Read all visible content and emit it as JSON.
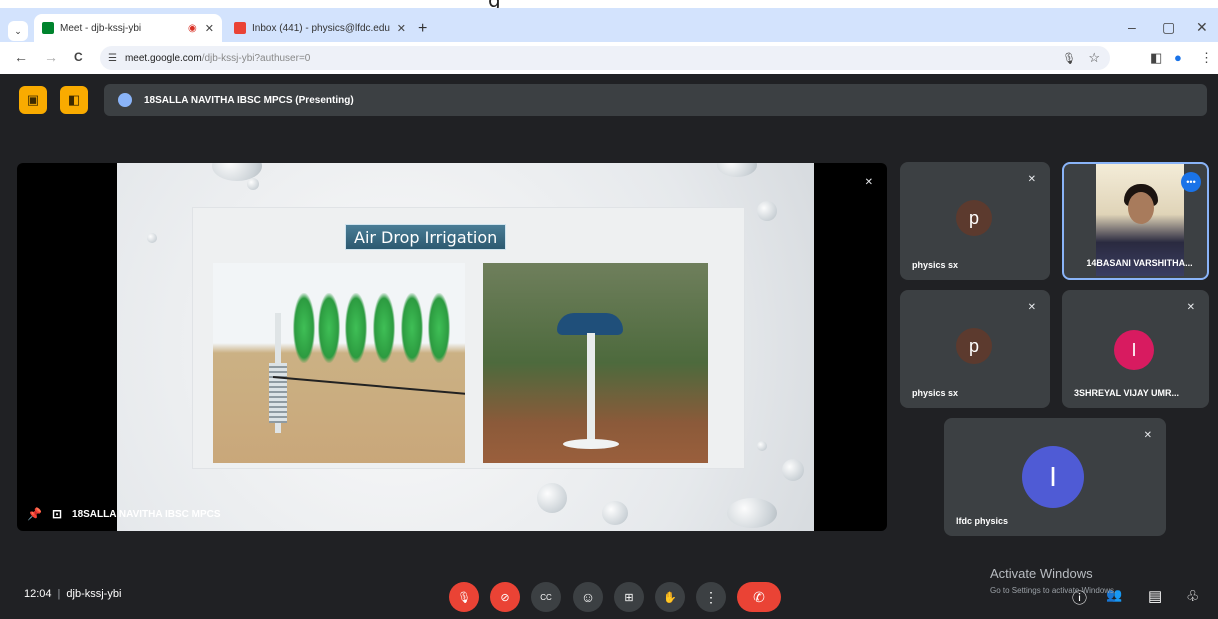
{
  "browser": {
    "tabs": [
      {
        "label": "Meet - djb-kssj-ybi",
        "recording": "◉",
        "close": "✕"
      },
      {
        "label": "Inbox (441) - physics@lfdc.edu",
        "close": "✕"
      }
    ],
    "tablist_icon": "⌄",
    "new_tab": "+",
    "window": {
      "minimize": "–",
      "maximize": "▢",
      "close": "✕"
    },
    "nav": {
      "back": "←",
      "forward": "→",
      "reload": "C"
    },
    "address": {
      "site_info": "☰",
      "host": "meet.google.com",
      "path": "/djb-kssj-ybi?authuser=0"
    },
    "right_icons": {
      "mic": "🎙",
      "bookmark": "☆",
      "sidepanel": "◧",
      "profile": "●",
      "menu": "⋮"
    },
    "top_overflow_glyph": "g"
  },
  "meet": {
    "top_buttons": [
      "▣",
      "◧"
    ],
    "presenting_text": "18SALLA NAVITHA IBSC MPCS (Presenting)",
    "slide": {
      "title": "Air Drop Irrigation"
    },
    "main_tile": {
      "pin_icon": "📌",
      "screen_icon": "⊡",
      "label": "18SALLA NAVITHA IBSC MPCS",
      "mic_off": "✕"
    },
    "participants": [
      {
        "name": "physics sx",
        "initial": "p",
        "color": "#5c3a2e"
      },
      {
        "name": "14BASANI VARSHITHA...",
        "video": true
      },
      {
        "name": "physics sx",
        "initial": "p",
        "color": "#5c3a2e"
      },
      {
        "name": "3SHREYAL VIJAY UMR...",
        "initial": "I",
        "color": "#d81b60"
      },
      {
        "name": "lfdc physics",
        "initial": "I",
        "color": "#4f5bd5"
      }
    ],
    "more_options": "•••",
    "meeting_time": "12:04",
    "separator": "|",
    "meeting_code": "djb-kssj-ybi",
    "controls": {
      "mic": "🎙",
      "camera": "⊘",
      "captions": "CC",
      "emoji": "☺",
      "present": "⊞",
      "raise_hand": "✋",
      "more": "⋮",
      "hangup": "✆"
    },
    "right_controls": {
      "info": "ⓘ",
      "people": "👥",
      "chat": "▤",
      "activities": "♧"
    },
    "watermark": {
      "line1": "Activate Windows",
      "line2": "Go to Settings to activate Windows."
    }
  }
}
